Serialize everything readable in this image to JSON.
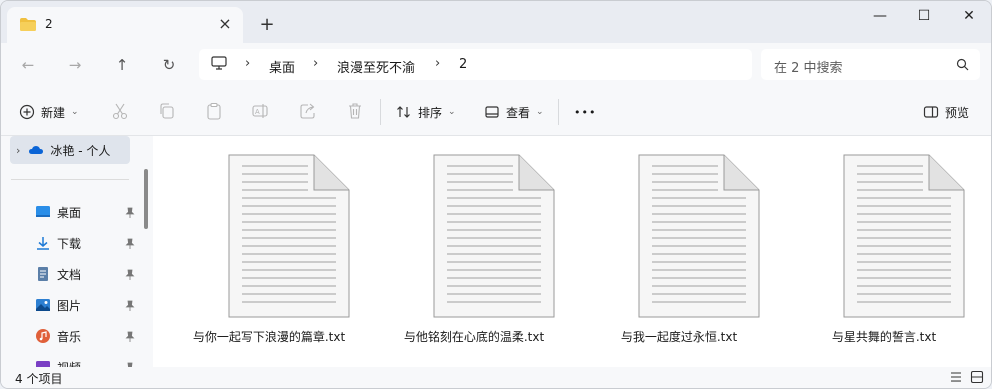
{
  "window": {
    "tab_title": "2",
    "tab_close": "×",
    "new_tab": "+",
    "minimize": "—",
    "maximize": "☐",
    "close": "✕"
  },
  "nav": {
    "back": "←",
    "forward": "→",
    "up": "↑",
    "refresh": "↻"
  },
  "breadcrumb": {
    "separator": "›",
    "items": [
      "桌面",
      "浪漫至死不渝",
      "2"
    ]
  },
  "search": {
    "placeholder": "在 2 中搜索"
  },
  "toolbar": {
    "new_label": "新建",
    "sort_label": "排序",
    "view_label": "查看",
    "more_label": "•••",
    "preview_label": "预览"
  },
  "sidebar": {
    "cloud": "冰艳 - 个人",
    "items": [
      {
        "label": "桌面",
        "icon": "desktop-icon"
      },
      {
        "label": "下载",
        "icon": "download-icon"
      },
      {
        "label": "文档",
        "icon": "documents-icon"
      },
      {
        "label": "图片",
        "icon": "pictures-icon"
      },
      {
        "label": "音乐",
        "icon": "music-icon"
      },
      {
        "label": "视频",
        "icon": "videos-icon"
      }
    ]
  },
  "files": [
    {
      "name": "与你一起写下浪漫的篇章.txt"
    },
    {
      "name": "与他铭刻在心底的温柔.txt"
    },
    {
      "name": "与我一起度过永恒.txt"
    },
    {
      "name": "与星共舞的誓言.txt"
    }
  ],
  "status": {
    "count": "4 个项目"
  },
  "colors": {
    "accent": "#0067c0",
    "folder": "#f0c040"
  }
}
